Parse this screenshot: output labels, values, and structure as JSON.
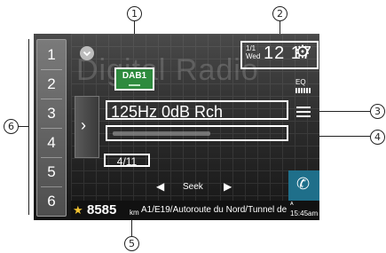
{
  "callouts": {
    "c1": "1",
    "c2": "2",
    "c3": "3",
    "c4": "4",
    "c5": "5",
    "c6": "6"
  },
  "watermark": "Digital Radio",
  "presets": [
    "1",
    "2",
    "3",
    "4",
    "5",
    "6"
  ],
  "side_arrow": "›",
  "band": "DAB1",
  "clock": {
    "date": "1/1",
    "weekday": "Wed",
    "time": "12 17"
  },
  "settings_icon": "gear-icon",
  "eq_label": "EQ",
  "frequency_line": "125Hz 0dB Rch",
  "channel": "4/11",
  "seek": {
    "prev": "◀",
    "label": "Seek",
    "next": "▶"
  },
  "navigation": {
    "distance": "8585",
    "unit": "km",
    "road": "A1/E19/Autoroute du Nord/Tunnel de",
    "arrival_prefix": "ᴬ",
    "arrival_time": "15:45am"
  },
  "colors": {
    "band_badge": "#2e8b3e",
    "phone_button": "#1f6f8a",
    "star": "#f2c230"
  }
}
